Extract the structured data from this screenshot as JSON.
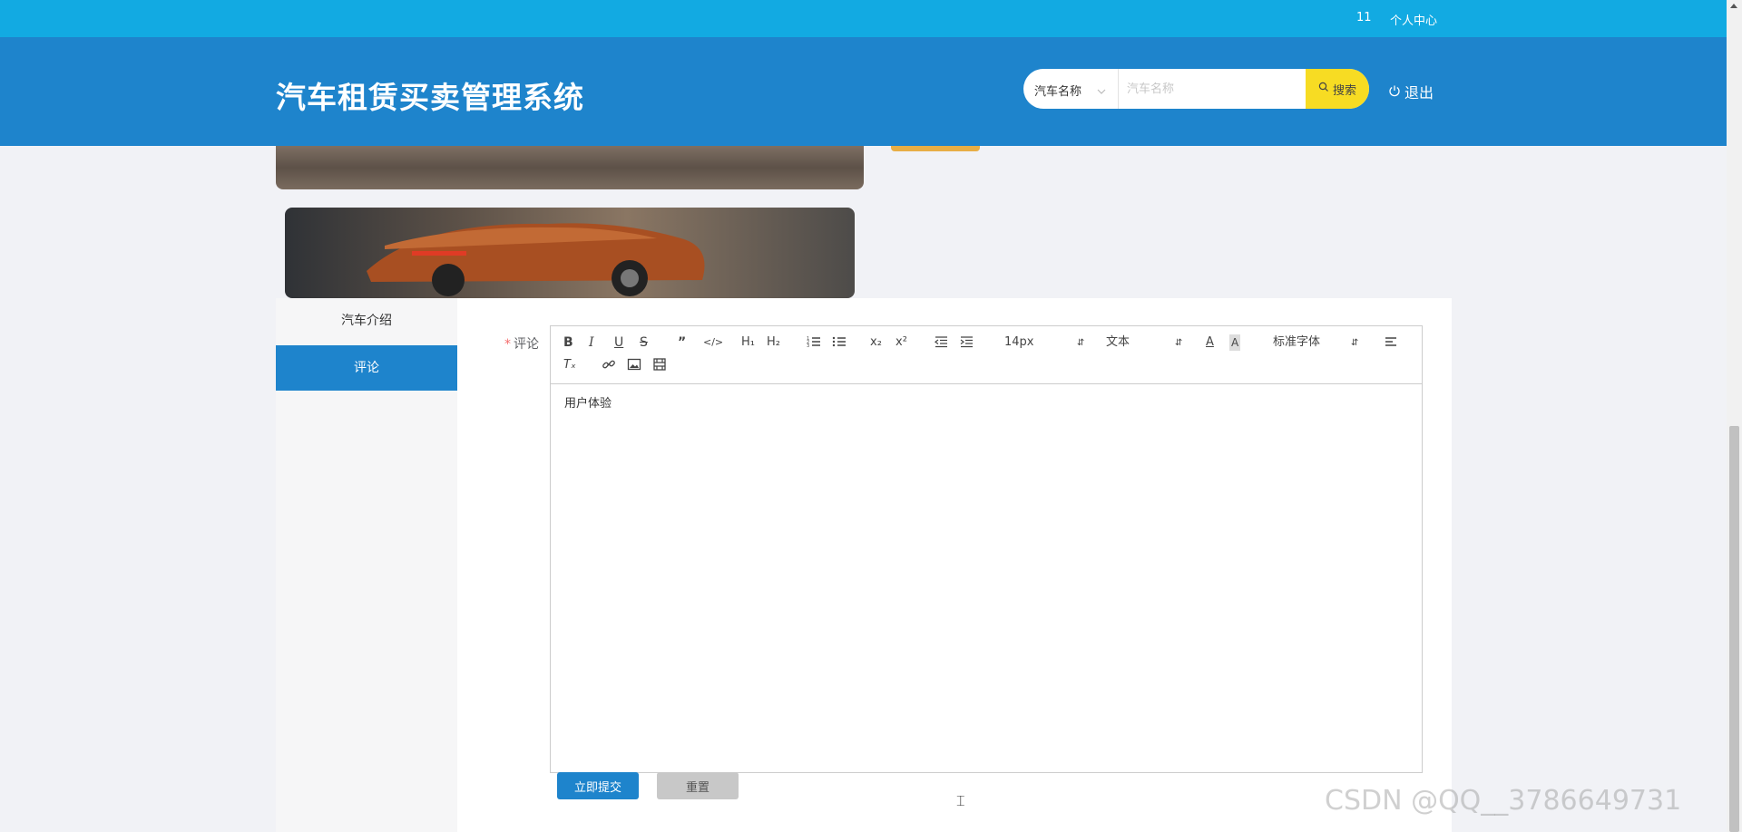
{
  "topbar": {
    "user_id": "11",
    "personal_center": "个人中心"
  },
  "header": {
    "title": "汽车租赁买卖管理系统",
    "search": {
      "field_selected": "汽车名称",
      "placeholder": "汽车名称",
      "button_label": "搜索"
    },
    "logout_label": "退出"
  },
  "tabs": [
    {
      "label": "汽车介绍",
      "active": false
    },
    {
      "label": "评论",
      "active": true
    }
  ],
  "form": {
    "required_mark": "*",
    "comment_label": "评论",
    "editor": {
      "font_size": "14px",
      "block_type": "文本",
      "font_family": "标准字体",
      "content": "用户体验"
    },
    "submit_label": "立即提交",
    "reset_label": "重置"
  },
  "watermark": "CSDN @QQ__3786649731",
  "colors": {
    "topbar": "#12aae2",
    "header": "#1e84cc",
    "search_button": "#f7dc23",
    "active_tab": "#1e84cc"
  }
}
